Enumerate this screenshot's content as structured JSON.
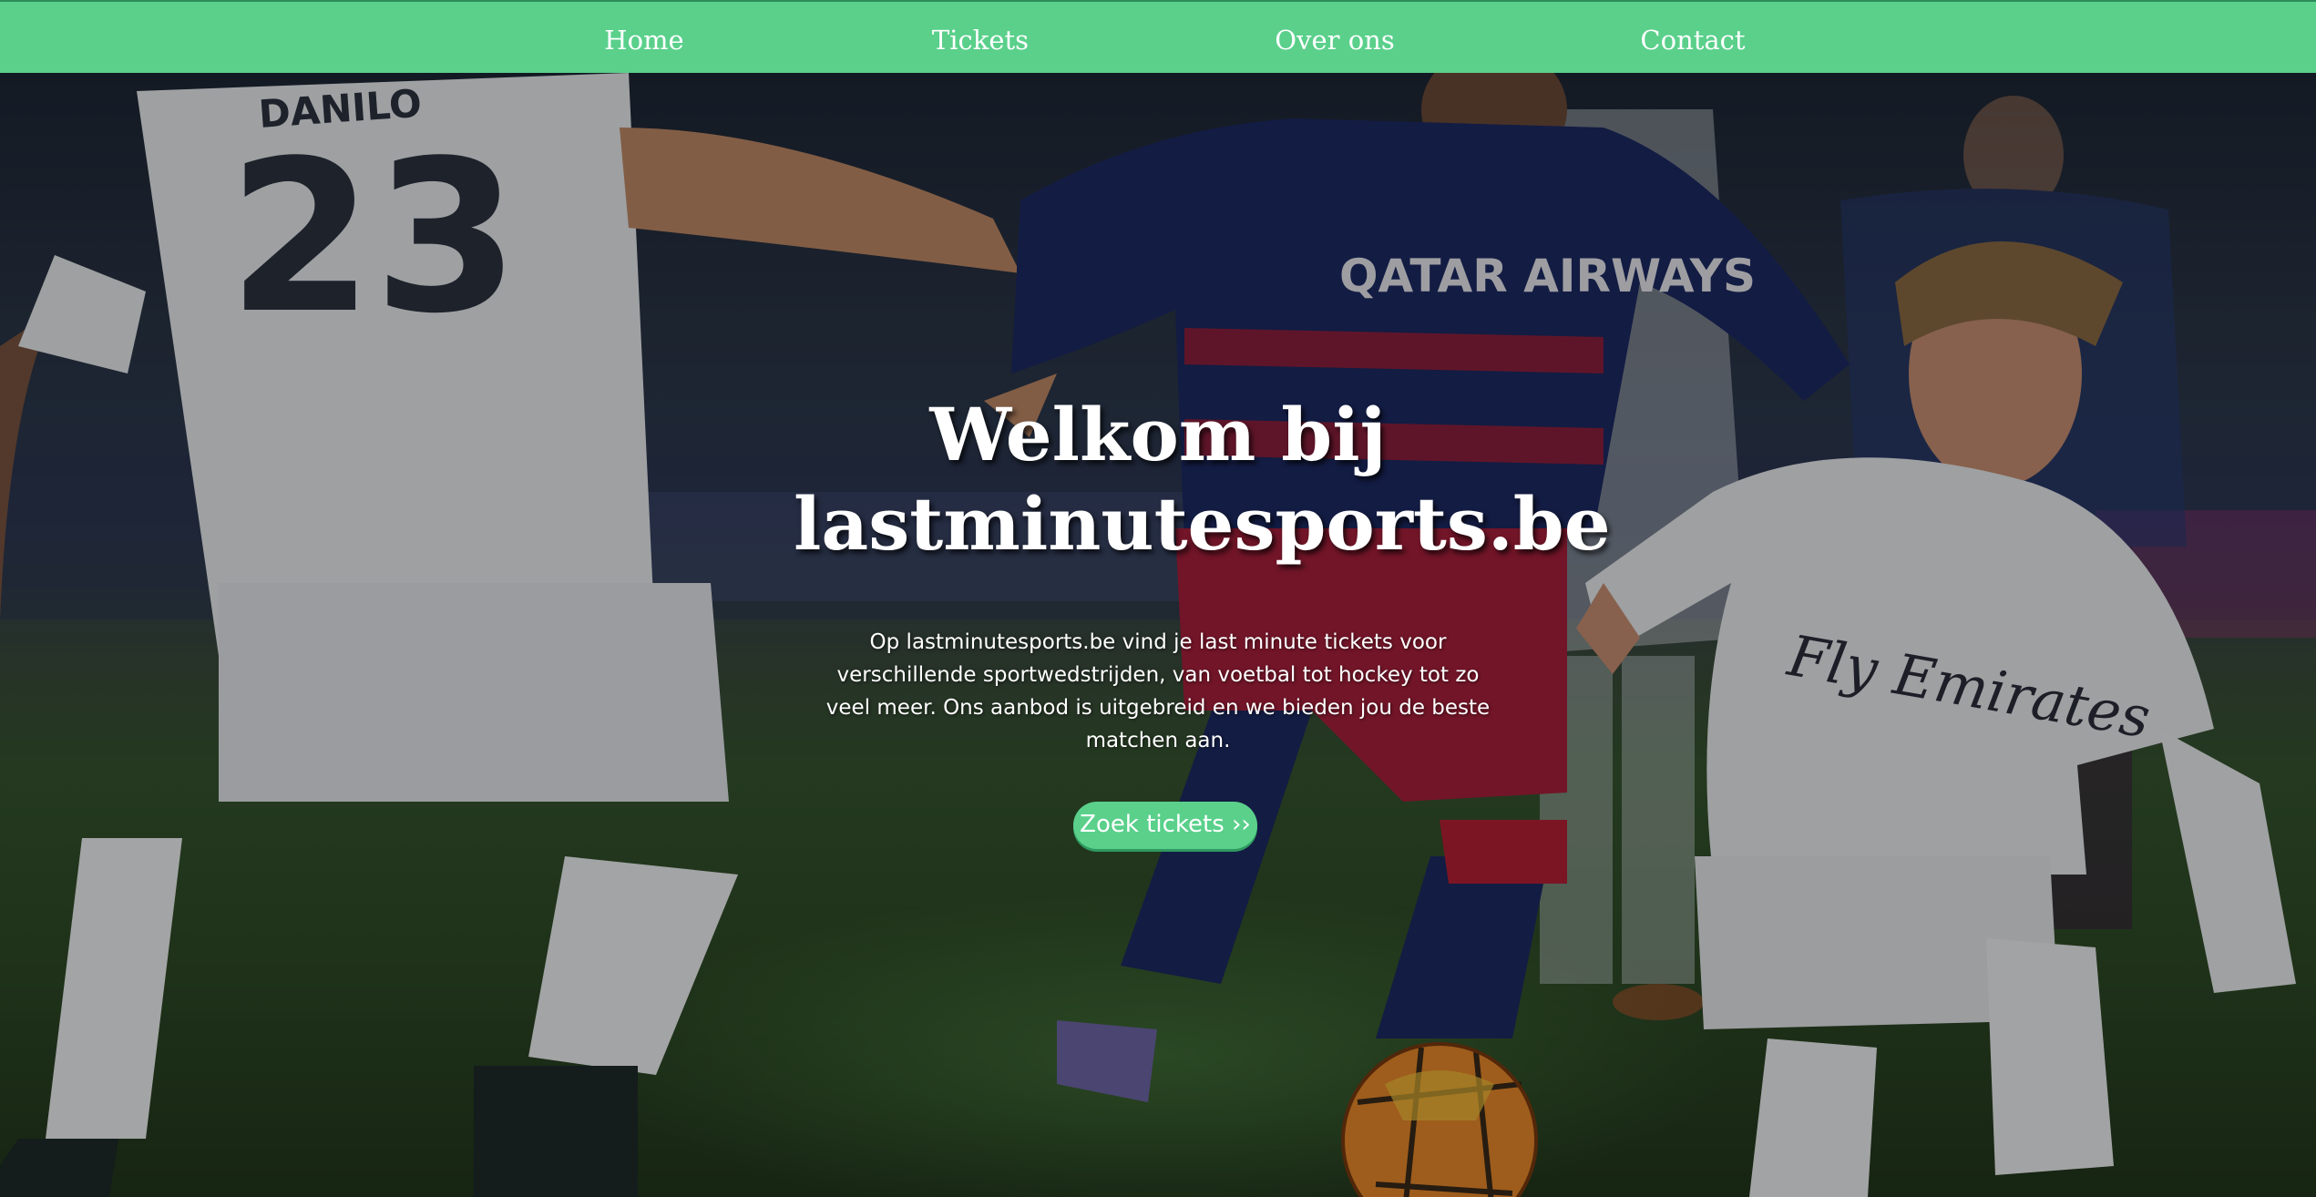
{
  "nav": {
    "items": [
      {
        "label": "Home"
      },
      {
        "label": "Tickets"
      },
      {
        "label": "Over ons"
      },
      {
        "label": "Contact"
      }
    ]
  },
  "hero": {
    "title": "Welkom bij lastminutesports.be",
    "text": "Op lastminutesports.be vind je last minute tickets voor verschillende sportwedstrijden, van voetbal tot hockey tot zo veel meer. Ons aanbod is uitgebreid en we bieden jou de beste matchen aan.",
    "button_label": "Zoek tickets ››",
    "jersey_number": "23",
    "jersey_name": "DANILO",
    "sponsor_barca": "QATAR AIRWAYS",
    "sponsor_real": "Fly Emirates"
  },
  "colors": {
    "accent": "#5ad08b",
    "accent_dark": "#2e9a5f",
    "text_light": "#ffffff"
  },
  "icons": {
    "button_arrow": "double-chevron-right-icon"
  }
}
